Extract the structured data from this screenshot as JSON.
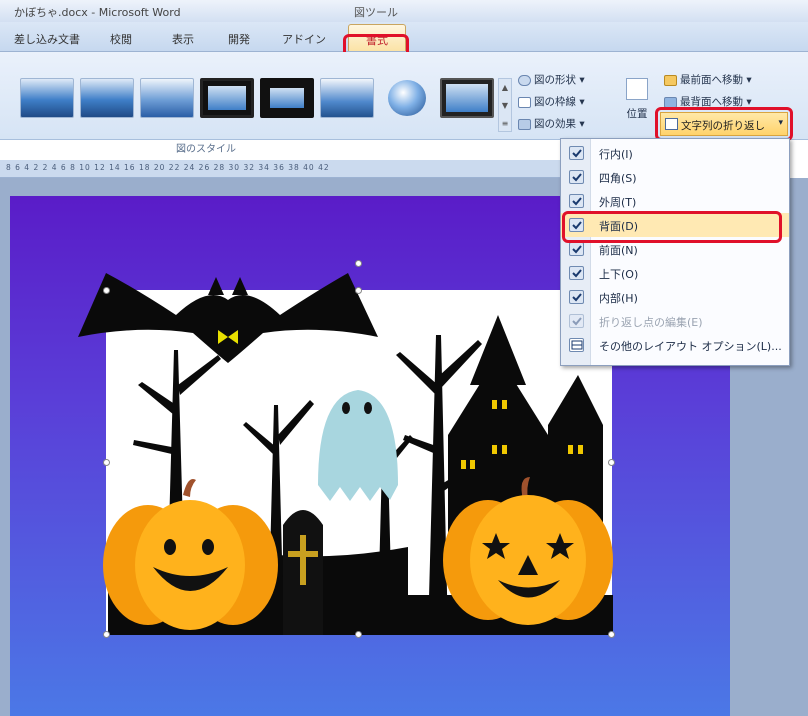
{
  "window": {
    "title": "かぼちゃ.docx - Microsoft Word",
    "tool_context": "図ツール"
  },
  "tabs": [
    {
      "label": "差し込み文書"
    },
    {
      "label": "校閲"
    },
    {
      "label": "表示"
    },
    {
      "label": "開発"
    },
    {
      "label": "アドイン"
    }
  ],
  "active_tab": {
    "label": "書式"
  },
  "ribbon": {
    "group_label": "図のスタイル",
    "shape_buttons": [
      {
        "label": "図の形状"
      },
      {
        "label": "図の枠線"
      },
      {
        "label": "図の効果"
      }
    ],
    "position_label": "位置",
    "arrange_buttons": [
      {
        "label": "最前面へ移動"
      },
      {
        "label": "最背面へ移動"
      }
    ],
    "wrap_label": "文字列の折り返し"
  },
  "ruler": {
    "labels": "8 6 4 2   2 4 6 8 10 12 14 16 18 20 22 24 26 28 30 32 34 36 38 40 42"
  },
  "wrap_menu": {
    "items": [
      {
        "label": "行内(I)",
        "disabled": false,
        "highlighted": false
      },
      {
        "label": "四角(S)",
        "disabled": false,
        "highlighted": false
      },
      {
        "label": "外周(T)",
        "disabled": false,
        "highlighted": false
      },
      {
        "label": "背面(D)",
        "disabled": false,
        "highlighted": true
      },
      {
        "label": "前面(N)",
        "disabled": false,
        "highlighted": false
      },
      {
        "label": "上下(O)",
        "disabled": false,
        "highlighted": false
      },
      {
        "label": "内部(H)",
        "disabled": false,
        "highlighted": false
      },
      {
        "label": "折り返し点の編集(E)",
        "disabled": true,
        "highlighted": false
      },
      {
        "label": "その他のレイアウト オプション(L)...",
        "disabled": false,
        "highlighted": false
      }
    ]
  },
  "colors": {
    "highlight_box": "#e0102a",
    "page_gradient_top": "#5a1cc8",
    "page_gradient_bottom": "#4b78e6",
    "pumpkin": "#f59a0c"
  },
  "picture": {
    "description_icon": "halloween-clipart"
  }
}
